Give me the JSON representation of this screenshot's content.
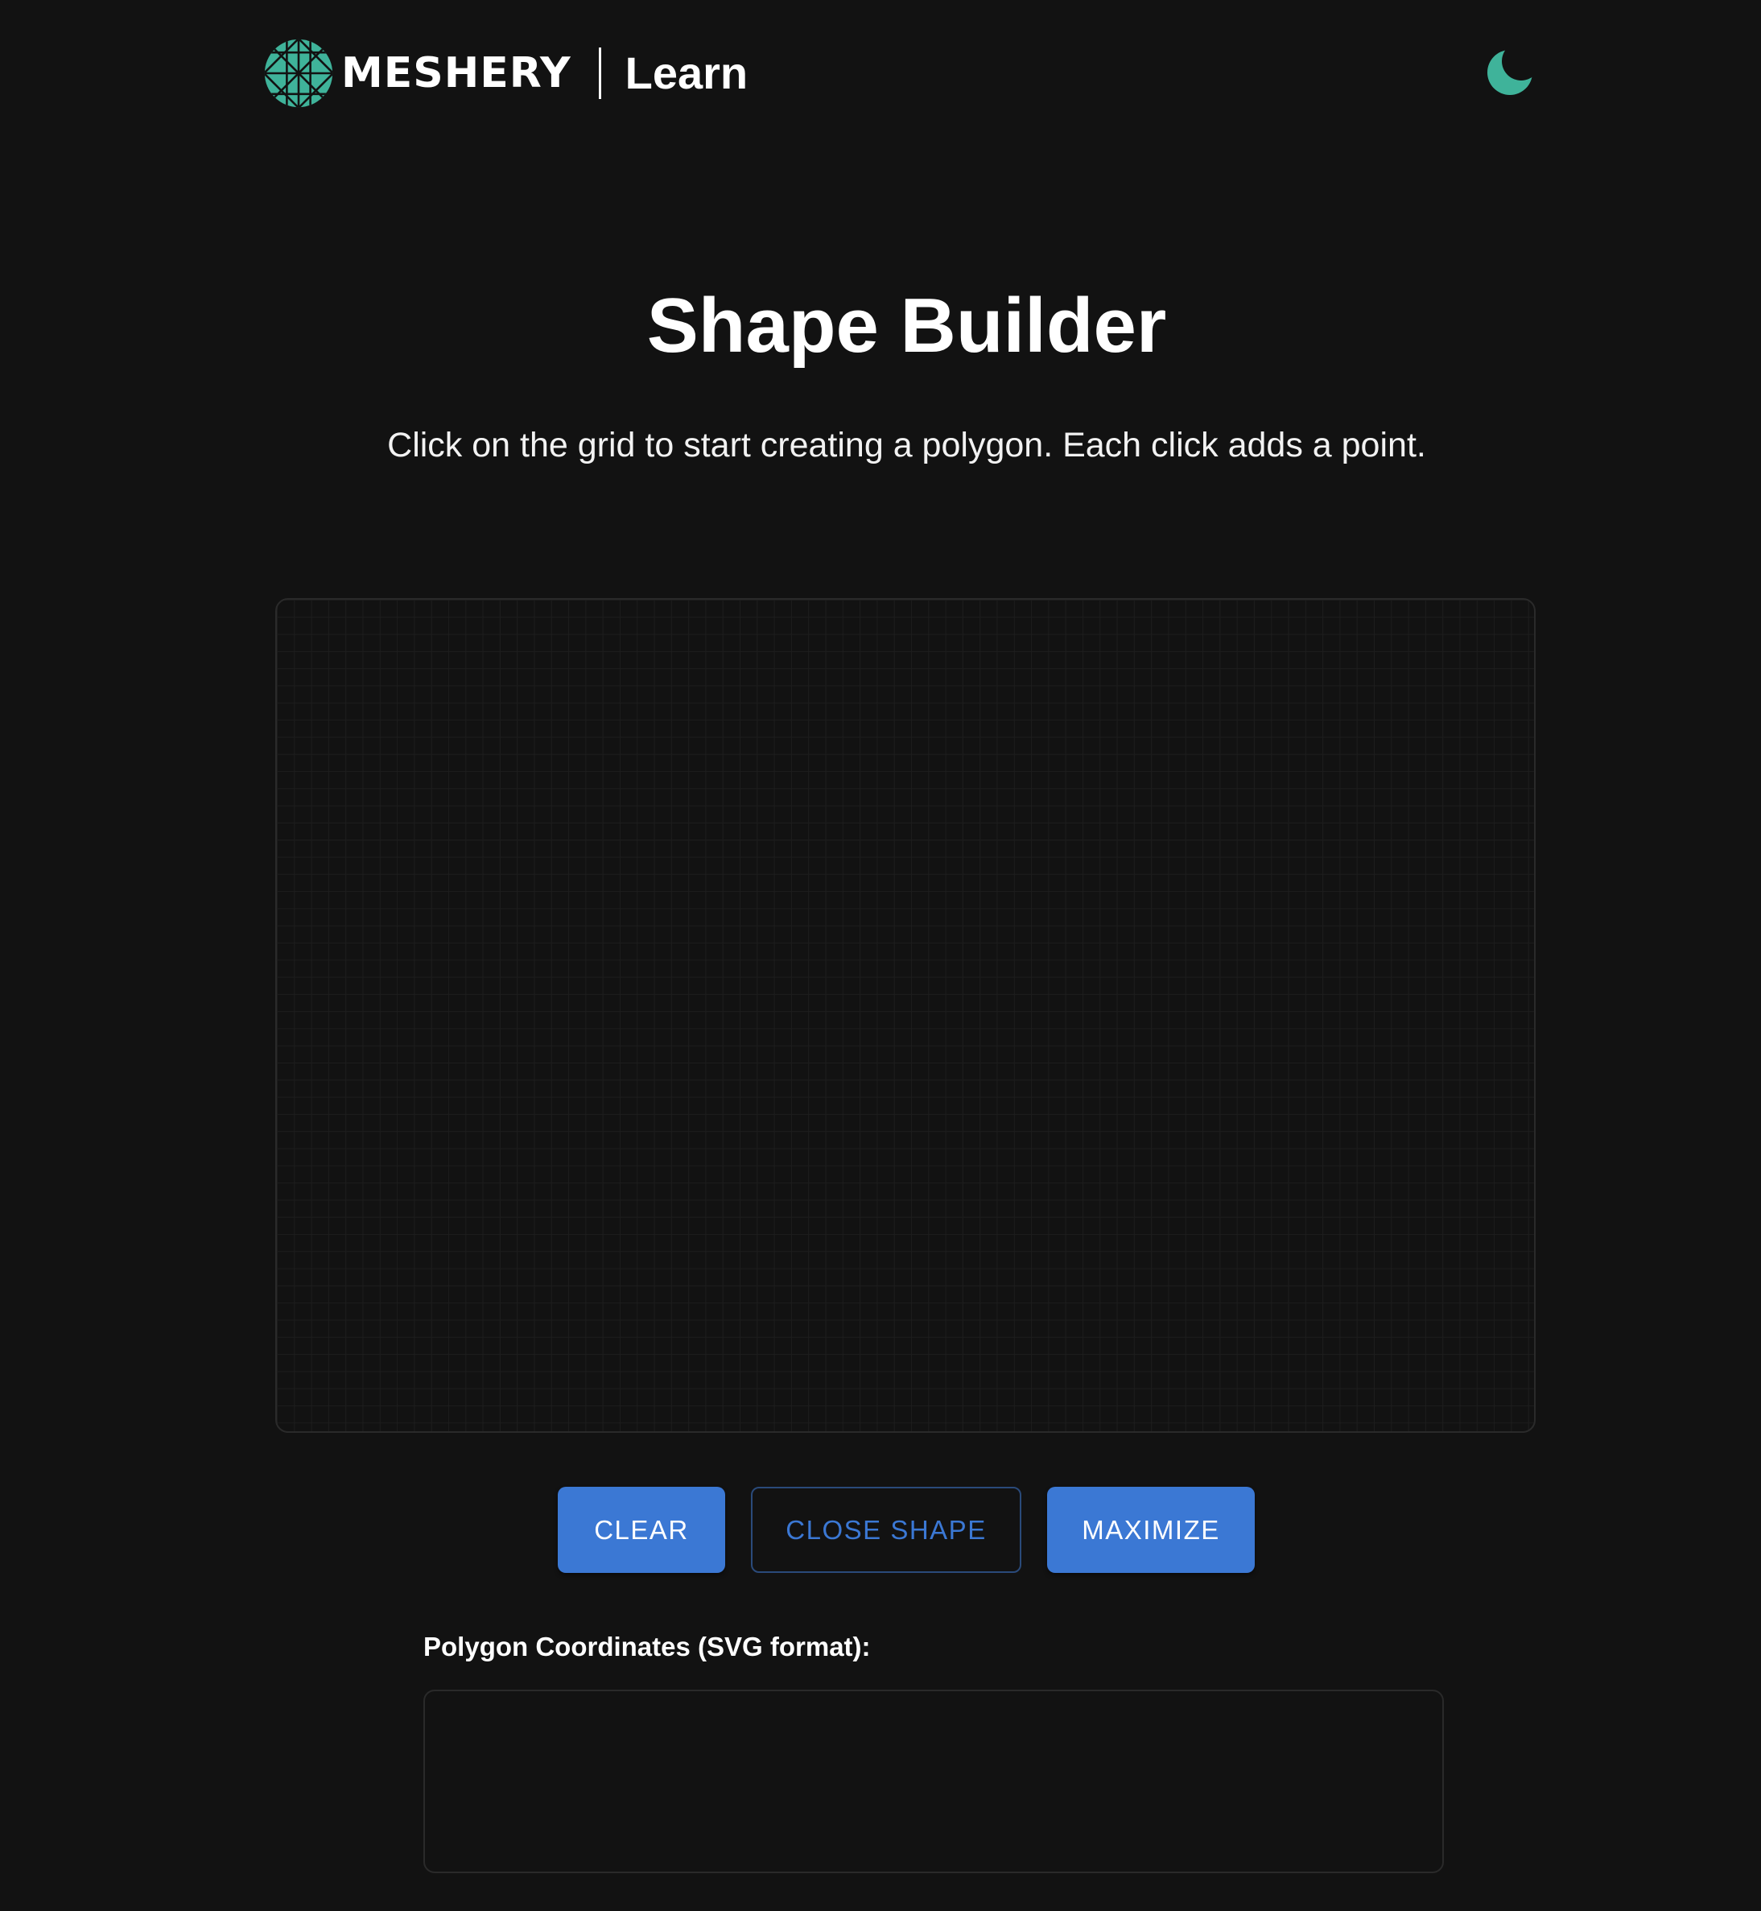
{
  "header": {
    "brand": "MESHERY",
    "section": "Learn",
    "logo_icon": "meshery-logo-icon",
    "theme_toggle_icon": "moon-icon"
  },
  "main": {
    "title": "Shape Builder",
    "instructions": "Click on the grid to start creating a polygon. Each click adds a point."
  },
  "controls": {
    "clear_label": "CLEAR",
    "close_shape_label": "CLOSE SHAPE",
    "maximize_label": "MAXIMIZE"
  },
  "output": {
    "label": "Polygon Coordinates (SVG format):",
    "value": ""
  },
  "colors": {
    "background": "#121212",
    "accent": "#3b78d4",
    "brand_green": "#3fb39a"
  }
}
